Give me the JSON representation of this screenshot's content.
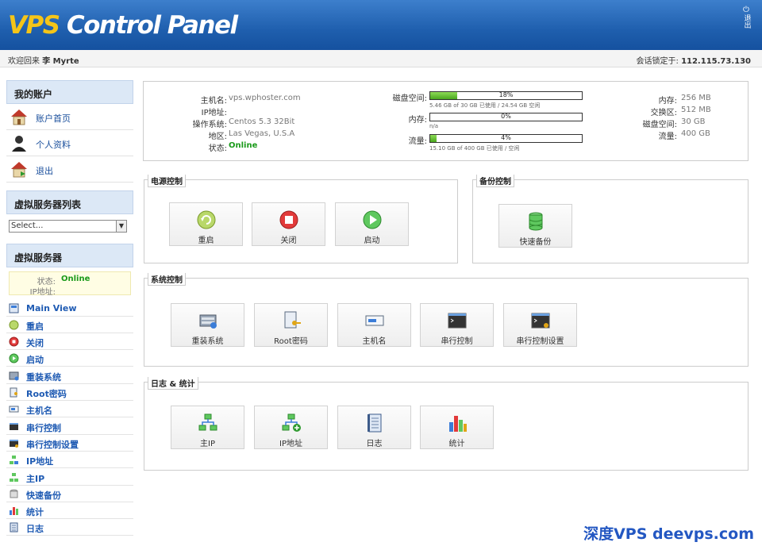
{
  "header": {
    "logo_vps": "VPS",
    "logo_rest": " Control Panel",
    "logout_label": "退出"
  },
  "welcome": {
    "prefix": "欢迎回来",
    "user": "李 Myrte",
    "session_prefix": "会话锁定于:",
    "session_ip": "112.115.73.130"
  },
  "sidebar": {
    "account_title": "我的账户",
    "account_items": [
      {
        "label": "账户首页",
        "icon": "home-icon"
      },
      {
        "label": "个人资料",
        "icon": "user-icon"
      },
      {
        "label": "退出",
        "icon": "logout-home-icon"
      }
    ],
    "vps_list_title": "虚拟服务器列表",
    "select_value": "Select...",
    "vps_title": "虚拟服务器",
    "status_label": "状态:",
    "status_value": "Online",
    "ip_label": "IP地址:",
    "nav_items": [
      {
        "label": "Main View",
        "icon": "main-view-icon"
      },
      {
        "label": "重启",
        "icon": "reboot-icon"
      },
      {
        "label": "关闭",
        "icon": "shutdown-icon"
      },
      {
        "label": "启动",
        "icon": "boot-icon"
      },
      {
        "label": "重装系统",
        "icon": "reinstall-icon"
      },
      {
        "label": "Root密码",
        "icon": "root-password-icon"
      },
      {
        "label": "主机名",
        "icon": "hostname-icon"
      },
      {
        "label": "串行控制",
        "icon": "serial-console-icon"
      },
      {
        "label": "串行控制设置",
        "icon": "serial-console-settings-icon"
      },
      {
        "label": "IP地址",
        "icon": "ip-address-icon"
      },
      {
        "label": "主IP",
        "icon": "main-ip-icon"
      },
      {
        "label": "快速备份",
        "icon": "quick-backup-icon"
      },
      {
        "label": "统计",
        "icon": "statistics-icon"
      },
      {
        "label": "日志",
        "icon": "log-icon"
      }
    ]
  },
  "info": {
    "hostname_label": "主机名:",
    "hostname_value": "vps.wphoster.com",
    "ip_label": "IP地址:",
    "os_label": "操作系统:",
    "os_value": "Centos 5.3 32Bit",
    "region_label": "地区:",
    "region_value": "Las Vegas, U.S.A",
    "status_label": "状态:",
    "status_value": "Online",
    "disk_label": "磁盘空间:",
    "disk_pct_text": "18%",
    "disk_pct": 18,
    "disk_sub": "5.46 GB of 30 GB 已使用 / 24.54 GB 空闲",
    "mem_label": "内存:",
    "mem_pct_text": "0%",
    "mem_pct": 0,
    "mem_sub": "n/a",
    "traffic_label": "流量:",
    "traffic_pct_text": "4%",
    "traffic_pct": 4,
    "traffic_sub": "15.10 GB of 400 GB 已使用 / 空闲",
    "r_mem_label": "内存:",
    "r_mem_value": "256 MB",
    "r_swap_label": "交换区:",
    "r_swap_value": "512 MB",
    "r_disk_label": "磁盘空间:",
    "r_disk_value": "30 GB",
    "r_traffic_label": "流量:",
    "r_traffic_value": "400 GB"
  },
  "power": {
    "title": "电源控制",
    "reboot": "重启",
    "shutdown": "关闭",
    "boot": "启动"
  },
  "backup": {
    "title": "备份控制",
    "quick_backup": "快速备份"
  },
  "system": {
    "title": "系统控制",
    "reinstall": "重装系统",
    "root_password": "Root密码",
    "hostname": "主机名",
    "serial_console": "串行控制",
    "serial_console_settings": "串行控制设置"
  },
  "logs": {
    "title": "日志 & 统计",
    "main_ip": "主IP",
    "ip_address": "IP地址",
    "log": "日志",
    "statistics": "统计"
  },
  "watermark": "深度VPS deevps.com",
  "colors": {
    "header_blue": "#1f5fae",
    "logo_yellow": "#f5c518",
    "online_green": "#1a9a1a",
    "link_blue": "#1f5bb3",
    "bar_green": "#4aa81e"
  }
}
